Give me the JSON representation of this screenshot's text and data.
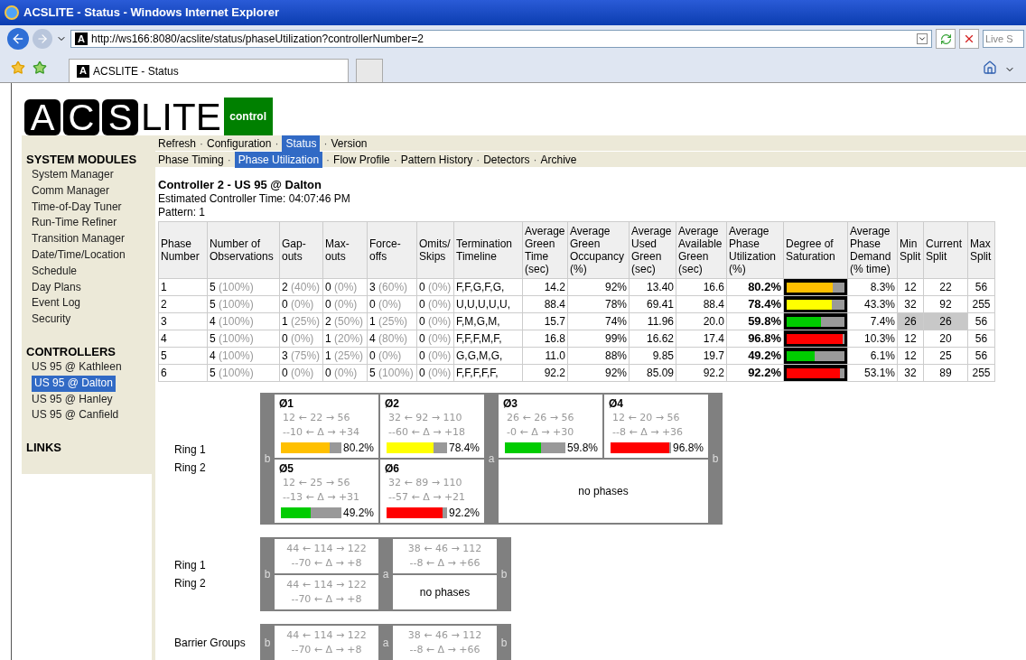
{
  "browser": {
    "title": "ACSLITE - Status - Windows Internet Explorer",
    "url": "http://ws166:8080/acslite/status/phaseUtilization?controllerNumber=2",
    "search_placeholder": "Live S",
    "tab_title": "ACSLITE - Status",
    "address_icon": "A",
    "tab_icon": "A"
  },
  "logo": {
    "letters": [
      "A",
      "C",
      "S"
    ],
    "rest": "LITE",
    "badge": "control"
  },
  "sidebar": {
    "sections": [
      {
        "title": "SYSTEM MODULES",
        "items": [
          {
            "label": "System Manager",
            "selected": false
          },
          {
            "label": "Comm Manager",
            "selected": false
          },
          {
            "label": "Time-of-Day Tuner",
            "selected": false
          },
          {
            "label": "Run-Time Refiner",
            "selected": false
          },
          {
            "label": "Transition Manager",
            "selected": false
          },
          {
            "label": "Date/Time/Location",
            "selected": false
          },
          {
            "label": "Schedule",
            "selected": false
          },
          {
            "label": "Day Plans",
            "selected": false
          },
          {
            "label": "Event Log",
            "selected": false
          },
          {
            "label": "Security",
            "selected": false
          }
        ]
      },
      {
        "title": "CONTROLLERS",
        "items": [
          {
            "label": "US 95 @ Kathleen",
            "selected": false
          },
          {
            "label": "US 95 @ Dalton",
            "selected": true
          },
          {
            "label": "US 95 @ Hanley",
            "selected": false
          },
          {
            "label": "US 95 @ Canfield",
            "selected": false
          }
        ]
      },
      {
        "title": "LINKS"
      }
    ]
  },
  "nav": {
    "separator": "·",
    "rows": [
      {
        "items": [
          {
            "label": "Refresh",
            "selected": false
          },
          {
            "label": "Configuration",
            "selected": false
          },
          {
            "label": "Status",
            "selected": true
          },
          {
            "label": "Version",
            "selected": false
          }
        ]
      },
      {
        "items": [
          {
            "label": "Phase Timing",
            "selected": false
          },
          {
            "label": "Phase Utilization",
            "selected": true
          },
          {
            "label": "Flow Profile",
            "selected": false
          },
          {
            "label": "Pattern History",
            "selected": false
          },
          {
            "label": "Detectors",
            "selected": false
          },
          {
            "label": "Archive",
            "selected": false
          }
        ]
      }
    ]
  },
  "heading": "Controller 2 - US 95 @ Dalton",
  "controller_time": "Estimated Controller Time: 04:07:46 PM",
  "pattern": "Pattern: 1",
  "table": {
    "columns": [
      "Phase Number",
      "Number of Observations",
      "Gap- outs",
      "Max- outs",
      "Force- offs",
      "Omits/ Skips",
      "Termination Timeline",
      "Average Green Time (sec)",
      "Average Green Occupancy (%)",
      "Average Used Green (sec)",
      "Average Available Green (sec)",
      "Average Phase Utilization (%)",
      "Degree of Saturation",
      "Average Phase Demand (% time)",
      "Min Split",
      "Current Split",
      "Max Split"
    ],
    "rows": [
      {
        "phase": "1",
        "observations": [
          "5",
          "(100%)"
        ],
        "gap_outs": [
          "2",
          "(40%)"
        ],
        "max_outs": [
          "0",
          "(0%)"
        ],
        "force_offs": [
          "3",
          "(60%)"
        ],
        "omits": [
          "0",
          "(0%)"
        ],
        "timeline": "F,F,G,F,G,",
        "green_time": "14.2",
        "occupancy": "92%",
        "used_green": "13.40",
        "available_green": "16.6",
        "utilization": "80.2%",
        "saturation": {
          "level": 0.8,
          "color": "#ffc000"
        },
        "demand": "8.3%",
        "min_split": "12",
        "current_split": "22",
        "max_split": "56",
        "split_highlighted": false
      },
      {
        "phase": "2",
        "observations": [
          "5",
          "(100%)"
        ],
        "gap_outs": [
          "0",
          "(0%)"
        ],
        "max_outs": [
          "0",
          "(0%)"
        ],
        "force_offs": [
          "0",
          "(0%)"
        ],
        "omits": [
          "0",
          "(0%)"
        ],
        "timeline": "U,U,U,U,U,",
        "green_time": "88.4",
        "occupancy": "78%",
        "used_green": "69.41",
        "available_green": "88.4",
        "utilization": "78.4%",
        "saturation": {
          "level": 0.78,
          "color": "#ffff00"
        },
        "demand": "43.3%",
        "min_split": "32",
        "current_split": "92",
        "max_split": "255",
        "split_highlighted": false
      },
      {
        "phase": "3",
        "observations": [
          "4",
          "(100%)"
        ],
        "gap_outs": [
          "1",
          "(25%)"
        ],
        "max_outs": [
          "2",
          "(50%)"
        ],
        "force_offs": [
          "1",
          "(25%)"
        ],
        "omits": [
          "0",
          "(0%)"
        ],
        "timeline": "F,M,G,M,",
        "green_time": "15.7",
        "occupancy": "74%",
        "used_green": "11.96",
        "available_green": "20.0",
        "utilization": "59.8%",
        "saturation": {
          "level": 0.6,
          "color": "#00cc00"
        },
        "demand": "7.4%",
        "min_split": "26",
        "current_split": "26",
        "max_split": "56",
        "split_highlighted": true
      },
      {
        "phase": "4",
        "observations": [
          "5",
          "(100%)"
        ],
        "gap_outs": [
          "0",
          "(0%)"
        ],
        "max_outs": [
          "1",
          "(20%)"
        ],
        "force_offs": [
          "4",
          "(80%)"
        ],
        "omits": [
          "0",
          "(0%)"
        ],
        "timeline": "F,F,F,M,F,",
        "green_time": "16.8",
        "occupancy": "99%",
        "used_green": "16.62",
        "available_green": "17.4",
        "utilization": "96.8%",
        "saturation": {
          "level": 0.97,
          "color": "#ff0000"
        },
        "demand": "10.3%",
        "min_split": "12",
        "current_split": "20",
        "max_split": "56",
        "split_highlighted": false
      },
      {
        "phase": "5",
        "observations": [
          "4",
          "(100%)"
        ],
        "gap_outs": [
          "3",
          "(75%)"
        ],
        "max_outs": [
          "1",
          "(25%)"
        ],
        "force_offs": [
          "0",
          "(0%)"
        ],
        "omits": [
          "0",
          "(0%)"
        ],
        "timeline": "G,G,M,G,",
        "green_time": "11.0",
        "occupancy": "88%",
        "used_green": "9.85",
        "available_green": "19.7",
        "utilization": "49.2%",
        "saturation": {
          "level": 0.49,
          "color": "#00cc00"
        },
        "demand": "6.1%",
        "min_split": "12",
        "current_split": "25",
        "max_split": "56",
        "split_highlighted": false
      },
      {
        "phase": "6",
        "observations": [
          "5",
          "(100%)"
        ],
        "gap_outs": [
          "0",
          "(0%)"
        ],
        "max_outs": [
          "0",
          "(0%)"
        ],
        "force_offs": [
          "5",
          "(100%)"
        ],
        "omits": [
          "0",
          "(0%)"
        ],
        "timeline": "F,F,F,F,F,",
        "green_time": "92.2",
        "occupancy": "92%",
        "used_green": "85.09",
        "available_green": "92.2",
        "utilization": "92.2%",
        "saturation": {
          "level": 0.92,
          "color": "#ff0000"
        },
        "demand": "53.1%",
        "min_split": "32",
        "current_split": "89",
        "max_split": "255",
        "split_highlighted": false
      }
    ]
  },
  "ring_diagram": {
    "ring_labels": [
      "Ring 1",
      "Ring 2"
    ],
    "barriers": [
      "b",
      "a",
      "b"
    ],
    "groups": [
      {
        "rings": [
          {
            "phases": [
              {
                "name": "Ø1",
                "split_line": "12 ← 22 → 56",
                "delta_line": "--10 ← Δ → +34",
                "level": 0.8,
                "color": "#ffc000",
                "reading": "80.2%"
              },
              {
                "name": "Ø2",
                "split_line": "32 ← 92 → 110",
                "delta_line": "--60 ← Δ → +18",
                "level": 0.78,
                "color": "#ffff00",
                "reading": "78.4%"
              }
            ]
          },
          {
            "phases": [
              {
                "name": "Ø5",
                "split_line": "12 ← 25 → 56",
                "delta_line": "--13 ← Δ → +31",
                "level": 0.49,
                "color": "#00cc00",
                "reading": "49.2%"
              },
              {
                "name": "Ø6",
                "split_line": "32 ← 89 → 110",
                "delta_line": "--57 ← Δ → +21",
                "level": 0.92,
                "color": "#ff0000",
                "reading": "92.2%"
              }
            ]
          }
        ]
      },
      {
        "rings": [
          {
            "phases": [
              {
                "name": "Ø3",
                "split_line": "26 ← 26 → 56",
                "delta_line": "-0 ← Δ → +30",
                "level": 0.6,
                "color": "#00cc00",
                "reading": "59.8%"
              },
              {
                "name": "Ø4",
                "split_line": "12 ← 20 → 56",
                "delta_line": "--8 ← Δ → +36",
                "level": 0.97,
                "color": "#ff0000",
                "reading": "96.8%"
              }
            ]
          },
          {
            "note": "no phases"
          }
        ]
      }
    ]
  },
  "ring_summary": {
    "ring_labels": [
      "Ring 1",
      "Ring 2"
    ],
    "barriers": [
      "b",
      "a",
      "b"
    ],
    "groups": [
      {
        "rings": [
          {
            "split_line": "44 ← 114 → 122",
            "delta_line": "--70 ← Δ → +8"
          },
          {
            "split_line": "44 ← 114 → 122",
            "delta_line": "--70 ← Δ → +8"
          }
        ]
      },
      {
        "rings": [
          {
            "split_line": "38 ← 46 → 112",
            "delta_line": "--8 ← Δ → +66"
          },
          {
            "note": "no phases"
          }
        ]
      }
    ]
  },
  "barrier_groups": {
    "label": "Barrier Groups",
    "barriers": [
      "b",
      "a",
      "b"
    ],
    "groups": [
      {
        "split_line": "44 ← 114 → 122",
        "delta_line": "--70 ← Δ → +8"
      },
      {
        "split_line": "38 ← 46 → 112",
        "delta_line": "--8 ← Δ → +66"
      }
    ]
  }
}
